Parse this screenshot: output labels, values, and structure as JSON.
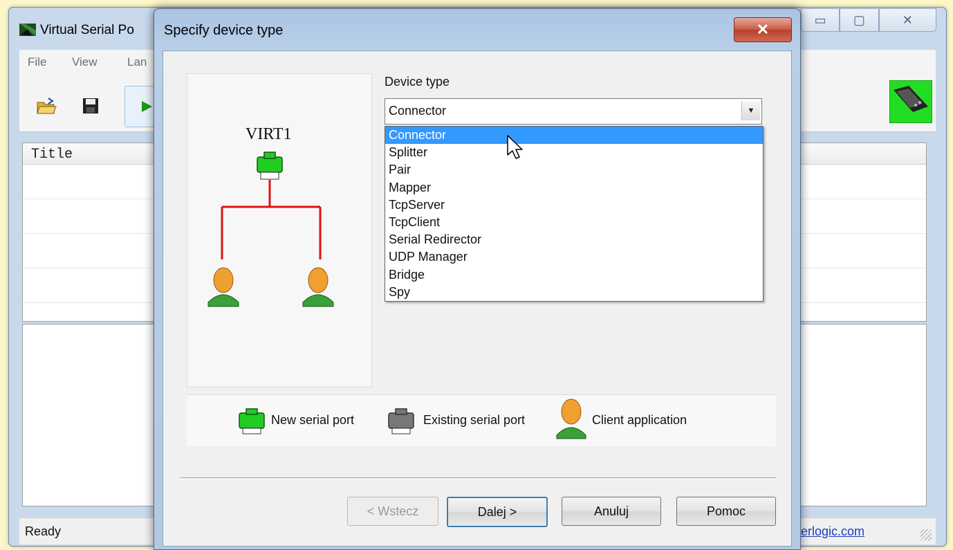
{
  "main_window": {
    "title": "Virtual Serial Po",
    "menu": [
      "File",
      "View",
      "Lan"
    ],
    "list_header": "Title",
    "status": "Ready",
    "status_link": "erlogic.com",
    "window_buttons": {
      "minimize": "▭",
      "maximize": "▢",
      "close": "✕"
    }
  },
  "dialog": {
    "title": "Specify device type",
    "close_glyph": "✕",
    "diagram_label": "VIRT1",
    "device_type_label": "Device type",
    "device_type_value": "Connector",
    "device_type_options": [
      "Connector",
      "Splitter",
      "Pair",
      "Mapper",
      "TcpServer",
      "TcpClient",
      "Serial Redirector",
      "UDP Manager",
      "Bridge",
      "Spy"
    ],
    "highlighted_option": "Connector",
    "legend": {
      "new_port": "New serial port",
      "existing_port": "Existing serial port",
      "client_app": "Client application"
    },
    "buttons": {
      "back": "< Wstecz",
      "next": "Dalej >",
      "cancel": "Anuluj",
      "help": "Pomoc"
    }
  },
  "colors": {
    "new_port": "#22cc22",
    "existing_port": "#777777",
    "connection_line": "#e01010",
    "selection": "#3399ff"
  }
}
